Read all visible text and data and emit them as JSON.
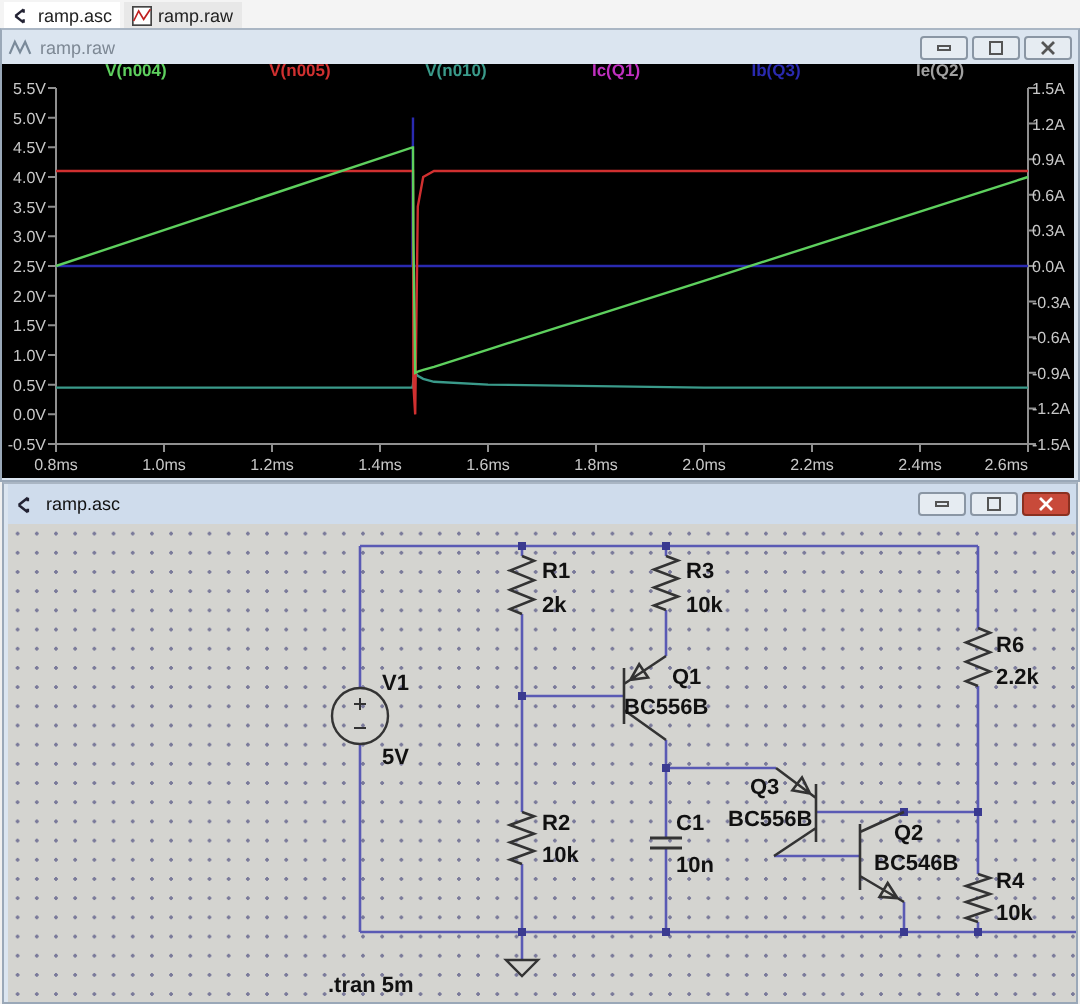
{
  "tabs": [
    {
      "label": "ramp.asc",
      "kind": "schematic",
      "selected": true
    },
    {
      "label": "ramp.raw",
      "kind": "waveform",
      "selected": false
    }
  ],
  "waveform_window": {
    "title": "ramp.raw",
    "active": false,
    "chart_data": {
      "type": "line",
      "x": [
        0.8,
        1.46,
        1.461,
        1.462,
        1.465,
        1.47,
        1.48,
        1.5,
        1.6,
        2.0,
        2.6
      ],
      "xlim": [
        0.8,
        2.6
      ],
      "ylim": [
        -0.5,
        5.5
      ],
      "y2lim": [
        -1.5,
        1.5
      ],
      "xticks": [
        {
          "value": 0.8,
          "label": "0.8ms"
        },
        {
          "value": 1.0,
          "label": "1.0ms"
        },
        {
          "value": 1.2,
          "label": "1.2ms"
        },
        {
          "value": 1.4,
          "label": "1.4ms"
        },
        {
          "value": 1.6,
          "label": "1.6ms"
        },
        {
          "value": 1.8,
          "label": "1.8ms"
        },
        {
          "value": 2.0,
          "label": "2.0ms"
        },
        {
          "value": 2.2,
          "label": "2.2ms"
        },
        {
          "value": 2.4,
          "label": "2.4ms"
        },
        {
          "value": 2.6,
          "label": "2.6ms"
        }
      ],
      "yticks": [
        {
          "value": 5.5,
          "label": "5.5V"
        },
        {
          "value": 5.0,
          "label": "5.0V"
        },
        {
          "value": 4.5,
          "label": "4.5V"
        },
        {
          "value": 4.0,
          "label": "4.0V"
        },
        {
          "value": 3.5,
          "label": "3.5V"
        },
        {
          "value": 3.0,
          "label": "3.0V"
        },
        {
          "value": 2.5,
          "label": "2.5V"
        },
        {
          "value": 2.0,
          "label": "2.0V"
        },
        {
          "value": 1.5,
          "label": "1.5V"
        },
        {
          "value": 1.0,
          "label": "1.0V"
        },
        {
          "value": 0.5,
          "label": "0.5V"
        },
        {
          "value": 0.0,
          "label": "0.0V"
        },
        {
          "value": -0.5,
          "label": "-0.5V"
        }
      ],
      "y2ticks": [
        {
          "value": 1.5,
          "label": "1.5A"
        },
        {
          "value": 1.2,
          "label": "1.2A"
        },
        {
          "value": 0.9,
          "label": "0.9A"
        },
        {
          "value": 0.6,
          "label": "0.6A"
        },
        {
          "value": 0.3,
          "label": "0.3A"
        },
        {
          "value": 0.0,
          "label": "0.0A"
        },
        {
          "value": -0.3,
          "label": "-0.3A"
        },
        {
          "value": -0.6,
          "label": "-0.6A"
        },
        {
          "value": -0.9,
          "label": "-0.9A"
        },
        {
          "value": -1.2,
          "label": "-1.2A"
        },
        {
          "value": -1.5,
          "label": "-1.5A"
        }
      ],
      "series": [
        {
          "name": "V(n004)",
          "color": "#5ed05e",
          "values": [
            2.5,
            4.5,
            4.5,
            3.0,
            0.7,
            0.72,
            0.75,
            0.8,
            1.09,
            2.25,
            4.0
          ]
        },
        {
          "name": "V(n005)",
          "color": "#d03030",
          "values": [
            4.1,
            4.1,
            4.1,
            0.5,
            0.0,
            3.5,
            4.0,
            4.1,
            4.1,
            4.1,
            4.1
          ]
        },
        {
          "name": "V(n010)",
          "color": "#3a9a8a",
          "values": [
            0.45,
            0.45,
            0.5,
            0.6,
            0.7,
            0.65,
            0.6,
            0.55,
            0.5,
            0.45,
            0.45
          ]
        },
        {
          "name": "Ic(Q1)",
          "color": "#c030c0",
          "values": [
            null,
            null,
            null,
            null,
            null,
            null,
            null,
            null,
            null,
            null,
            null
          ]
        },
        {
          "name": "Ib(Q3)",
          "color": "#2a2ab0",
          "axis": "y2",
          "values": [
            0,
            0,
            1.25,
            null,
            0,
            0,
            0,
            0,
            0,
            0,
            0
          ]
        },
        {
          "name": "Ie(Q2)",
          "color": "#a0a0a0",
          "values": [
            null,
            null,
            null,
            null,
            null,
            null,
            null,
            null,
            null,
            null,
            null
          ]
        }
      ]
    }
  },
  "schematic_window": {
    "title": "ramp.asc",
    "active": true,
    "components": [
      {
        "kind": "voltage_source",
        "ref": "V1",
        "value": "5V"
      },
      {
        "kind": "resistor",
        "ref": "R1",
        "value": "2k"
      },
      {
        "kind": "resistor",
        "ref": "R3",
        "value": "10k"
      },
      {
        "kind": "pnp",
        "ref": "Q1",
        "value": "BC556B"
      },
      {
        "kind": "resistor",
        "ref": "R2",
        "value": "10k"
      },
      {
        "kind": "capacitor",
        "ref": "C1",
        "value": "10n"
      },
      {
        "kind": "pnp",
        "ref": "Q3",
        "value": "BC556B"
      },
      {
        "kind": "npn",
        "ref": "Q2",
        "value": "BC546B"
      },
      {
        "kind": "resistor",
        "ref": "R6",
        "value": "2.2k"
      },
      {
        "kind": "resistor",
        "ref": "R4",
        "value": "10k"
      },
      {
        "kind": "ground"
      }
    ],
    "directive": ".tran 5m"
  }
}
